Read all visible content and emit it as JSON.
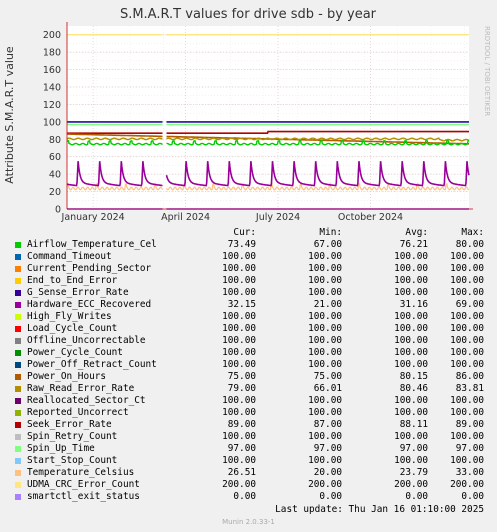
{
  "chart_data": {
    "type": "line",
    "title": "S.M.A.R.T values for drive sdb - by year",
    "ylabel": "Attribute S.M.A.R.T value",
    "ylim": [
      0,
      210
    ],
    "y_ticks": [
      0,
      20,
      40,
      60,
      80,
      100,
      120,
      140,
      160,
      180,
      200
    ],
    "x_tick_labels": [
      "January 2024",
      "April 2024",
      "July 2024",
      "October 2024"
    ],
    "grid": true,
    "watermark": "RRDTOOL / TOBI OETIKER",
    "colors": {
      "background": "#f0f0f0",
      "plot_background": "#ffffff",
      "grid": "#e2c8c8",
      "axis": "#cc0000"
    },
    "legend_headers": {
      "cur": "Cur:",
      "min": "Min:",
      "avg": "Avg:",
      "max": "Max:"
    },
    "series": [
      {
        "name": "Airflow_Temperature_Cel",
        "color": "#00cc00",
        "cur": "73.49",
        "min": "67.00",
        "avg": "76.21",
        "max": "80.00"
      },
      {
        "name": "Command_Timeout",
        "color": "#0066b3",
        "cur": "100.00",
        "min": "100.00",
        "avg": "100.00",
        "max": "100.00"
      },
      {
        "name": "Current_Pending_Sector",
        "color": "#ff8000",
        "cur": "100.00",
        "min": "100.00",
        "avg": "100.00",
        "max": "100.00"
      },
      {
        "name": "End_to_End_Error",
        "color": "#ffcc00",
        "cur": "100.00",
        "min": "100.00",
        "avg": "100.00",
        "max": "100.00"
      },
      {
        "name": "G_Sense_Error_Rate",
        "color": "#330099",
        "cur": "100.00",
        "min": "100.00",
        "avg": "100.00",
        "max": "100.00"
      },
      {
        "name": "Hardware_ECC_Recovered",
        "color": "#990099",
        "cur": "32.15",
        "min": "21.00",
        "avg": "31.16",
        "max": "69.00"
      },
      {
        "name": "High_Fly_Writes",
        "color": "#ccff00",
        "cur": "100.00",
        "min": "100.00",
        "avg": "100.00",
        "max": "100.00"
      },
      {
        "name": "Load_Cycle_Count",
        "color": "#ff0000",
        "cur": "100.00",
        "min": "100.00",
        "avg": "100.00",
        "max": "100.00"
      },
      {
        "name": "Offline_Uncorrectable",
        "color": "#808080",
        "cur": "100.00",
        "min": "100.00",
        "avg": "100.00",
        "max": "100.00"
      },
      {
        "name": "Power_Cycle_Count",
        "color": "#008f00",
        "cur": "100.00",
        "min": "100.00",
        "avg": "100.00",
        "max": "100.00"
      },
      {
        "name": "Power_Off_Retract_Count",
        "color": "#00487d",
        "cur": "100.00",
        "min": "100.00",
        "avg": "100.00",
        "max": "100.00"
      },
      {
        "name": "Power_On_Hours",
        "color": "#b35a00",
        "cur": "75.00",
        "min": "75.00",
        "avg": "80.15",
        "max": "86.00"
      },
      {
        "name": "Raw_Read_Error_Rate",
        "color": "#b38f00",
        "cur": "79.00",
        "min": "66.01",
        "avg": "80.46",
        "max": "83.81"
      },
      {
        "name": "Reallocated_Sector_Ct",
        "color": "#6b006b",
        "cur": "100.00",
        "min": "100.00",
        "avg": "100.00",
        "max": "100.00"
      },
      {
        "name": "Reported_Uncorrect",
        "color": "#8fb300",
        "cur": "100.00",
        "min": "100.00",
        "avg": "100.00",
        "max": "100.00"
      },
      {
        "name": "Seek_Error_Rate",
        "color": "#b30000",
        "cur": "89.00",
        "min": "87.00",
        "avg": "88.11",
        "max": "89.00"
      },
      {
        "name": "Spin_Retry_Count",
        "color": "#bebebe",
        "cur": "100.00",
        "min": "100.00",
        "avg": "100.00",
        "max": "100.00"
      },
      {
        "name": "Spin_Up_Time",
        "color": "#80ff80",
        "cur": "97.00",
        "min": "97.00",
        "avg": "97.00",
        "max": "97.00"
      },
      {
        "name": "Start_Stop_Count",
        "color": "#80c9ff",
        "cur": "100.00",
        "min": "100.00",
        "avg": "100.00",
        "max": "100.00"
      },
      {
        "name": "Temperature_Celsius",
        "color": "#ffc080",
        "cur": "26.51",
        "min": "20.00",
        "avg": "23.79",
        "max": "33.00"
      },
      {
        "name": "UDMA_CRC_Error_Count",
        "color": "#ffe680",
        "cur": "200.00",
        "min": "200.00",
        "avg": "200.00",
        "max": "200.00"
      },
      {
        "name": "smartctl_exit_status",
        "color": "#aa80ff",
        "cur": "0.00",
        "min": "0.00",
        "avg": "0.00",
        "max": "0.00"
      }
    ]
  },
  "last_update": "Last update:  Thu Jan 16 01:10:00 2025",
  "footer": "Munin 2.0.33-1"
}
